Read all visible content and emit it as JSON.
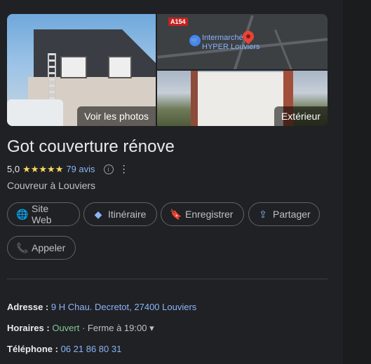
{
  "gallery": {
    "main_photo_label": "Voir les photos",
    "exterior_label": "Extérieur",
    "map": {
      "road_badge": "A154",
      "place_line1": "Intermarché",
      "place_line2": "HYPER Louviers"
    }
  },
  "business": {
    "name": "Got couverture rénove",
    "rating": "5,0",
    "stars": "★★★★★",
    "reviews": "79 avis",
    "category": "Couvreur à Louviers"
  },
  "actions": {
    "website": "Site Web",
    "directions": "Itinéraire",
    "save": "Enregistrer",
    "share": "Partager",
    "call": "Appeler"
  },
  "details": {
    "address_label": "Adresse :",
    "address_value": "9 H Chau. Decretot, 27400 Louviers",
    "hours_label": "Horaires :",
    "hours_status": "Ouvert",
    "hours_close": "· Ferme à 19:00",
    "phone_label": "Téléphone :",
    "phone_value": "06 21 86 80 31"
  },
  "colors": {
    "background": "#202124",
    "link": "#8ab4f8",
    "stars": "#fdd663",
    "open": "#81c995"
  }
}
